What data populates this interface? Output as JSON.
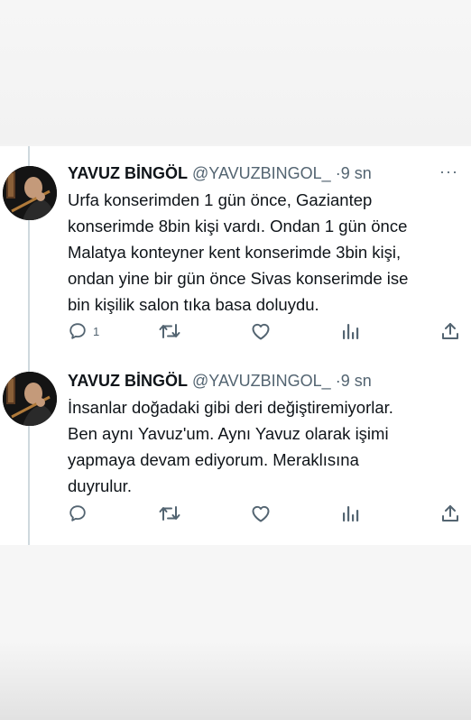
{
  "tweets": [
    {
      "name": "YAVUZ BİNGÖL",
      "handle": "@YAVUZBINGOL_",
      "dot": "·",
      "time": "9 sn",
      "more": "···",
      "lines": [
        "Urfa konserimden 1 gün önce, Gaziantep",
        "konserimde 8bin kişi vardı. Ondan 1 gün önce",
        "Malatya konteyner kent konserimde 3bin kişi,",
        "ondan yine bir gün önce Sivas konserimde ise",
        "bin kişilik salon tıka basa doluydu."
      ],
      "reply_count": "1",
      "icons": [
        "reply-icon",
        "retweet-icon",
        "like-icon",
        "views-icon",
        "share-icon"
      ]
    },
    {
      "name": "YAVUZ BİNGÖL",
      "handle": "@YAVUZBINGOL_",
      "dot": "·",
      "time": "9 sn",
      "more": "",
      "lines": [
        "İnsanlar doğadaki gibi deri değiştiremiyorlar.",
        "Ben aynı Yavuz'um. Aynı Yavuz olarak işimi",
        "yapmaya devam ediyorum. Meraklısına",
        "duyrulur."
      ],
      "reply_count": "",
      "icons": [
        "reply-icon",
        "retweet-icon",
        "like-icon",
        "views-icon",
        "share-icon"
      ]
    }
  ],
  "colors": {
    "text": "#0f1419",
    "muted": "#536471",
    "thread_line": "#cfd9de"
  }
}
